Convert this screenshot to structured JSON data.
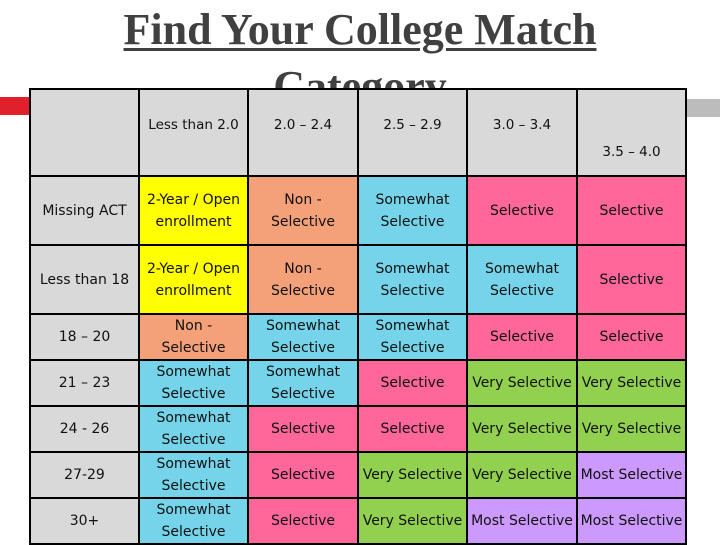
{
  "title": {
    "line1": "Find Your College Match",
    "line2": "Category"
  },
  "colors": {
    "header_bg": "#d9d9d9",
    "open_enrollment": "#ffff00",
    "non_selective": "#f4a079",
    "somewhat_selective": "#75d4ea",
    "selective": "#ff6699",
    "very_selective": "#92d050",
    "most_selective": "#cc99ff",
    "accent_left": "#e0202a",
    "accent_right": "#bcbcbc"
  },
  "table": {
    "columns": [
      "",
      "Less than 2.0",
      "2.0 – 2.4",
      "2.5 – 2.9",
      "3.0 – 3.4",
      "3.5 – 4.0"
    ],
    "rows": [
      {
        "label": "Missing ACT",
        "cells": [
          "2-Year / Open enrollment",
          "Non - Selective",
          "Somewhat Selective",
          "Selective",
          "Selective"
        ]
      },
      {
        "label": "Less than 18",
        "cells": [
          "2-Year / Open enrollment",
          "Non - Selective",
          "Somewhat Selective",
          "Somewhat Selective",
          "Selective"
        ]
      },
      {
        "label": "18 – 20",
        "cells": [
          "Non - Selective",
          "Somewhat Selective",
          "Somewhat Selective",
          "Selective",
          "Selective"
        ]
      },
      {
        "label": "21 – 23",
        "cells": [
          "Somewhat Selective",
          "Somewhat Selective",
          "Selective",
          "Very Selective",
          "Very Selective"
        ]
      },
      {
        "label": "24 - 26",
        "cells": [
          "Somewhat Selective",
          "Selective",
          "Selective",
          "Very Selective",
          "Very Selective"
        ]
      },
      {
        "label": "27-29",
        "cells": [
          "Somewhat Selective",
          "Selective",
          "Very Selective",
          "Very Selective",
          "Most Selective"
        ]
      },
      {
        "label": "30+",
        "cells": [
          "Somewhat Selective",
          "Selective",
          "Very Selective",
          "Most Selective",
          "Most Selective"
        ]
      }
    ]
  }
}
